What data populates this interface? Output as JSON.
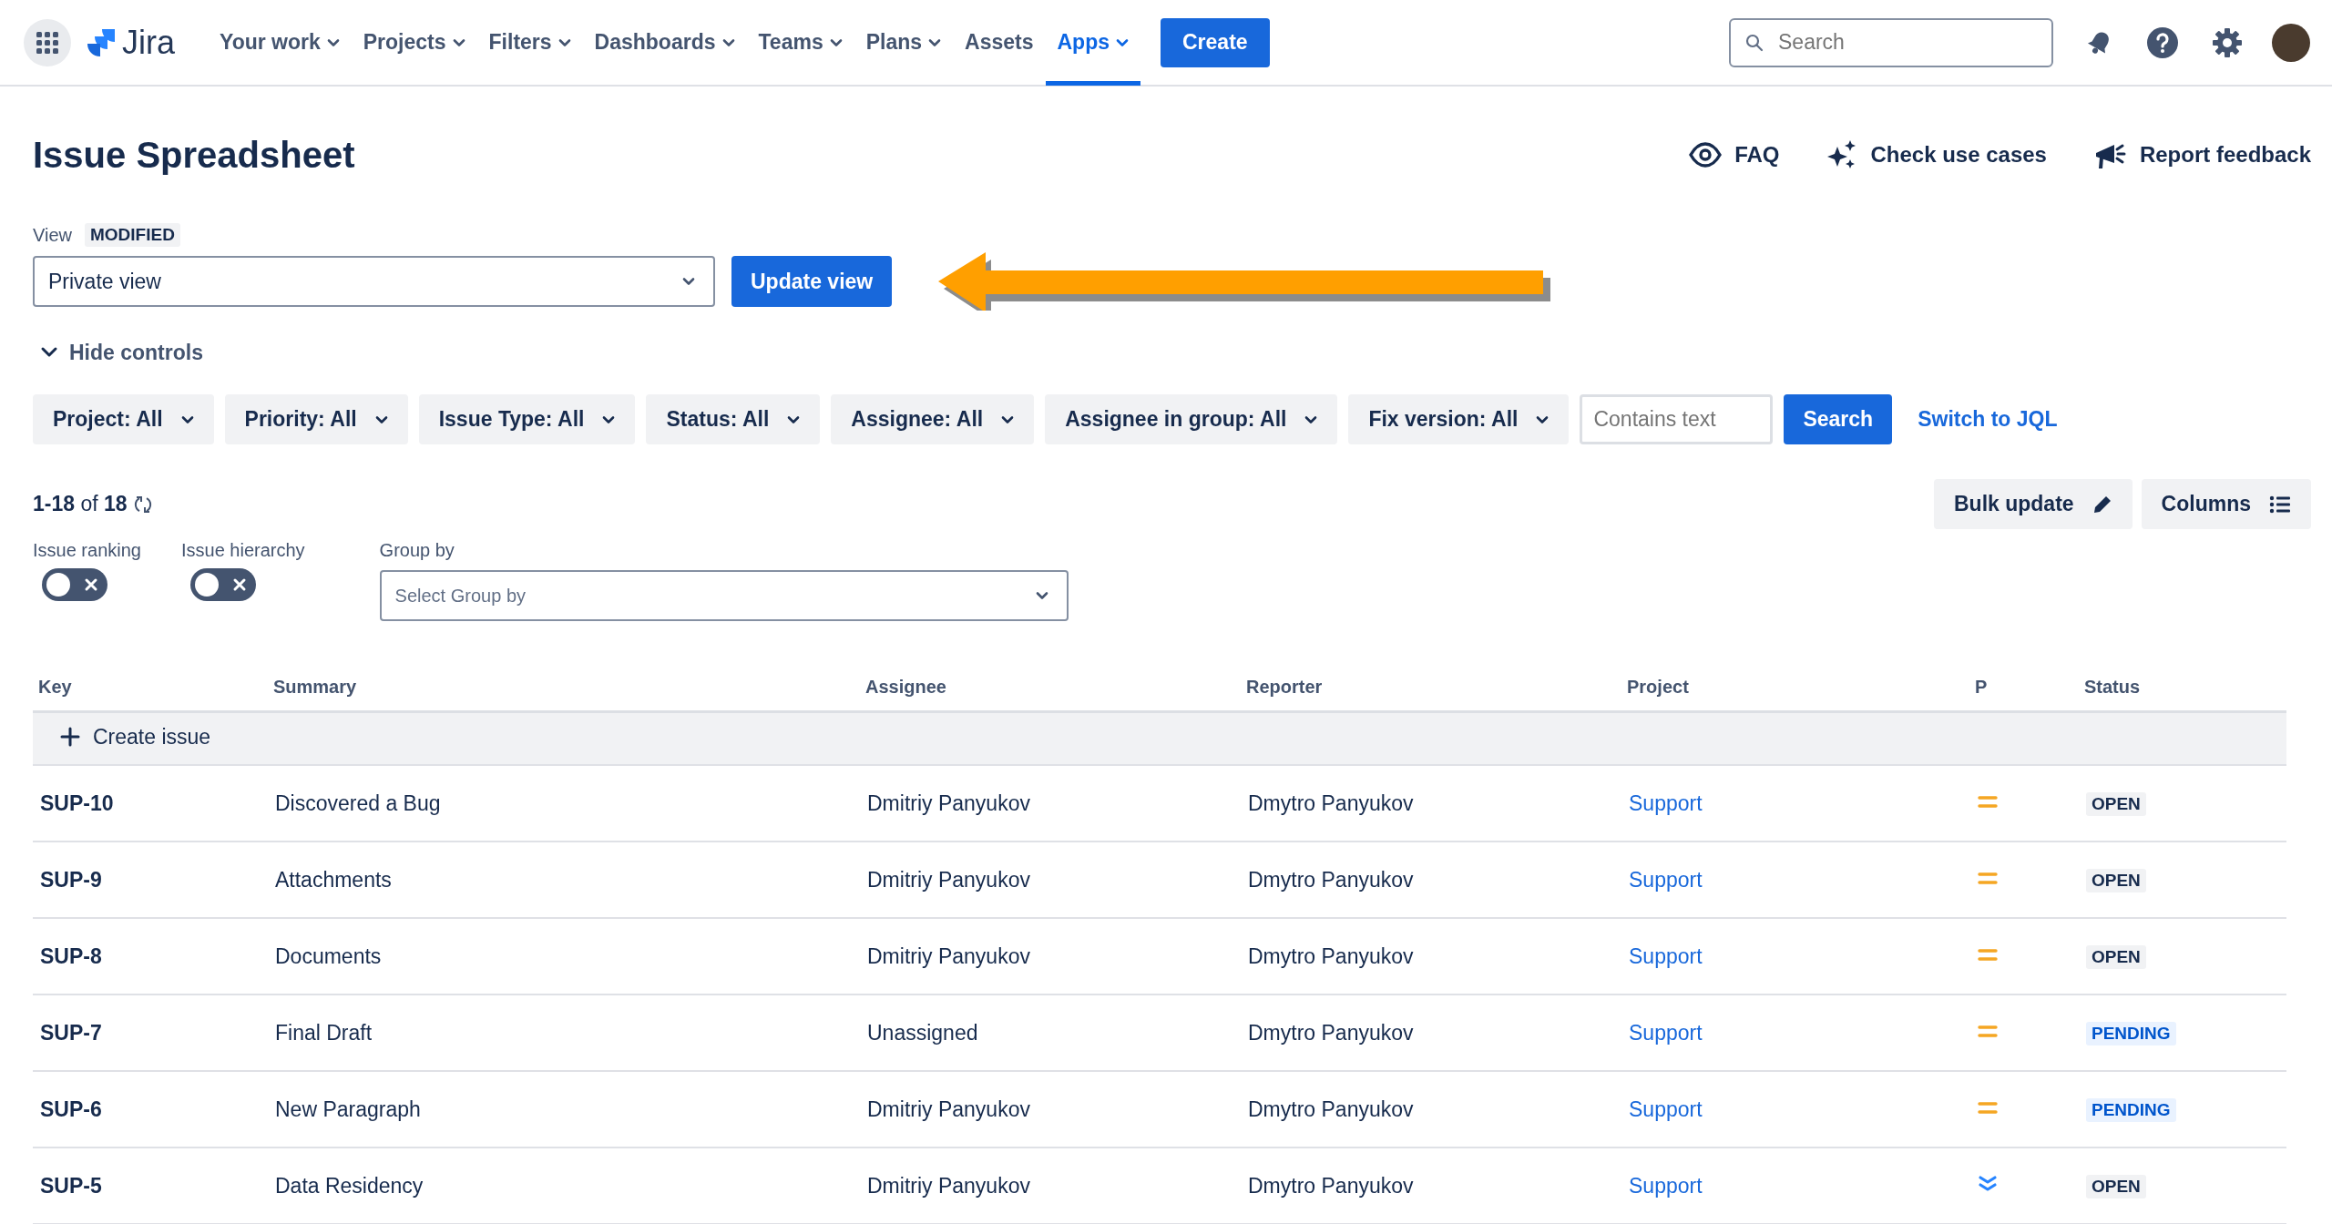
{
  "nav": {
    "product": "Jira",
    "items": [
      {
        "label": "Your work",
        "dropdown": true,
        "selected": false
      },
      {
        "label": "Projects",
        "dropdown": true,
        "selected": false
      },
      {
        "label": "Filters",
        "dropdown": true,
        "selected": false
      },
      {
        "label": "Dashboards",
        "dropdown": true,
        "selected": false
      },
      {
        "label": "Teams",
        "dropdown": true,
        "selected": false
      },
      {
        "label": "Plans",
        "dropdown": true,
        "selected": false
      },
      {
        "label": "Assets",
        "dropdown": false,
        "selected": false
      },
      {
        "label": "Apps",
        "dropdown": true,
        "selected": true
      }
    ],
    "create": "Create",
    "search": {
      "placeholder": "Search"
    }
  },
  "header": {
    "title": "Issue Spreadsheet",
    "actions": [
      {
        "kind": "eye",
        "label": "FAQ"
      },
      {
        "kind": "sparkle",
        "label": "Check use cases"
      },
      {
        "kind": "megaphone",
        "label": "Report feedback"
      }
    ]
  },
  "view": {
    "label": "View",
    "badge": "MODIFIED",
    "value": "Private view",
    "update": "Update view"
  },
  "hide_controls": "Hide controls",
  "filters": [
    {
      "label": "Project: All"
    },
    {
      "label": "Priority: All"
    },
    {
      "label": "Issue Type: All"
    },
    {
      "label": "Status: All"
    },
    {
      "label": "Assignee: All"
    },
    {
      "label": "Assignee in group: All"
    },
    {
      "label": "Fix version: All"
    }
  ],
  "text_search": {
    "placeholder": "Contains text",
    "button": "Search"
  },
  "switch_jql": "Switch to JQL",
  "count": {
    "range": "1-18",
    "of": "of",
    "total": "18"
  },
  "bulk_update": "Bulk update",
  "columns_button": "Columns",
  "toggles": [
    {
      "label": "Issue ranking",
      "on": false
    },
    {
      "label": "Issue hierarchy",
      "on": false
    }
  ],
  "group_by": {
    "label": "Group by",
    "placeholder": "Select Group by"
  },
  "table": {
    "columns": [
      "Key",
      "Summary",
      "Assignee",
      "Reporter",
      "Project",
      "P",
      "Status"
    ],
    "create": "Create issue",
    "rows": [
      {
        "key": "SUP-10",
        "summary": "Discovered a Bug",
        "assignee": "Dmitriy Panyukov",
        "reporter": "Dmytro Panyukov",
        "project": "Support",
        "priority": {
          "kind": "medium"
        },
        "status": {
          "label": "OPEN",
          "kind": "default"
        }
      },
      {
        "key": "SUP-9",
        "summary": "Attachments",
        "assignee": "Dmitriy Panyukov",
        "reporter": "Dmytro Panyukov",
        "project": "Support",
        "priority": {
          "kind": "medium"
        },
        "status": {
          "label": "OPEN",
          "kind": "default"
        }
      },
      {
        "key": "SUP-8",
        "summary": "Documents",
        "assignee": "Dmitriy Panyukov",
        "reporter": "Dmytro Panyukov",
        "project": "Support",
        "priority": {
          "kind": "medium"
        },
        "status": {
          "label": "OPEN",
          "kind": "default"
        }
      },
      {
        "key": "SUP-7",
        "summary": "Final Draft",
        "assignee": "Unassigned",
        "reporter": "Dmytro Panyukov",
        "project": "Support",
        "priority": {
          "kind": "medium"
        },
        "status": {
          "label": "PENDING",
          "kind": "inprogress"
        }
      },
      {
        "key": "SUP-6",
        "summary": "New Paragraph",
        "assignee": "Dmitriy Panyukov",
        "reporter": "Dmytro Panyukov",
        "project": "Support",
        "priority": {
          "kind": "medium"
        },
        "status": {
          "label": "PENDING",
          "kind": "inprogress"
        }
      },
      {
        "key": "SUP-5",
        "summary": "Data Residency",
        "assignee": "Dmitriy Panyukov",
        "reporter": "Dmytro Panyukov",
        "project": "Support",
        "priority": {
          "kind": "lowest"
        },
        "status": {
          "label": "OPEN",
          "kind": "default"
        }
      }
    ]
  }
}
